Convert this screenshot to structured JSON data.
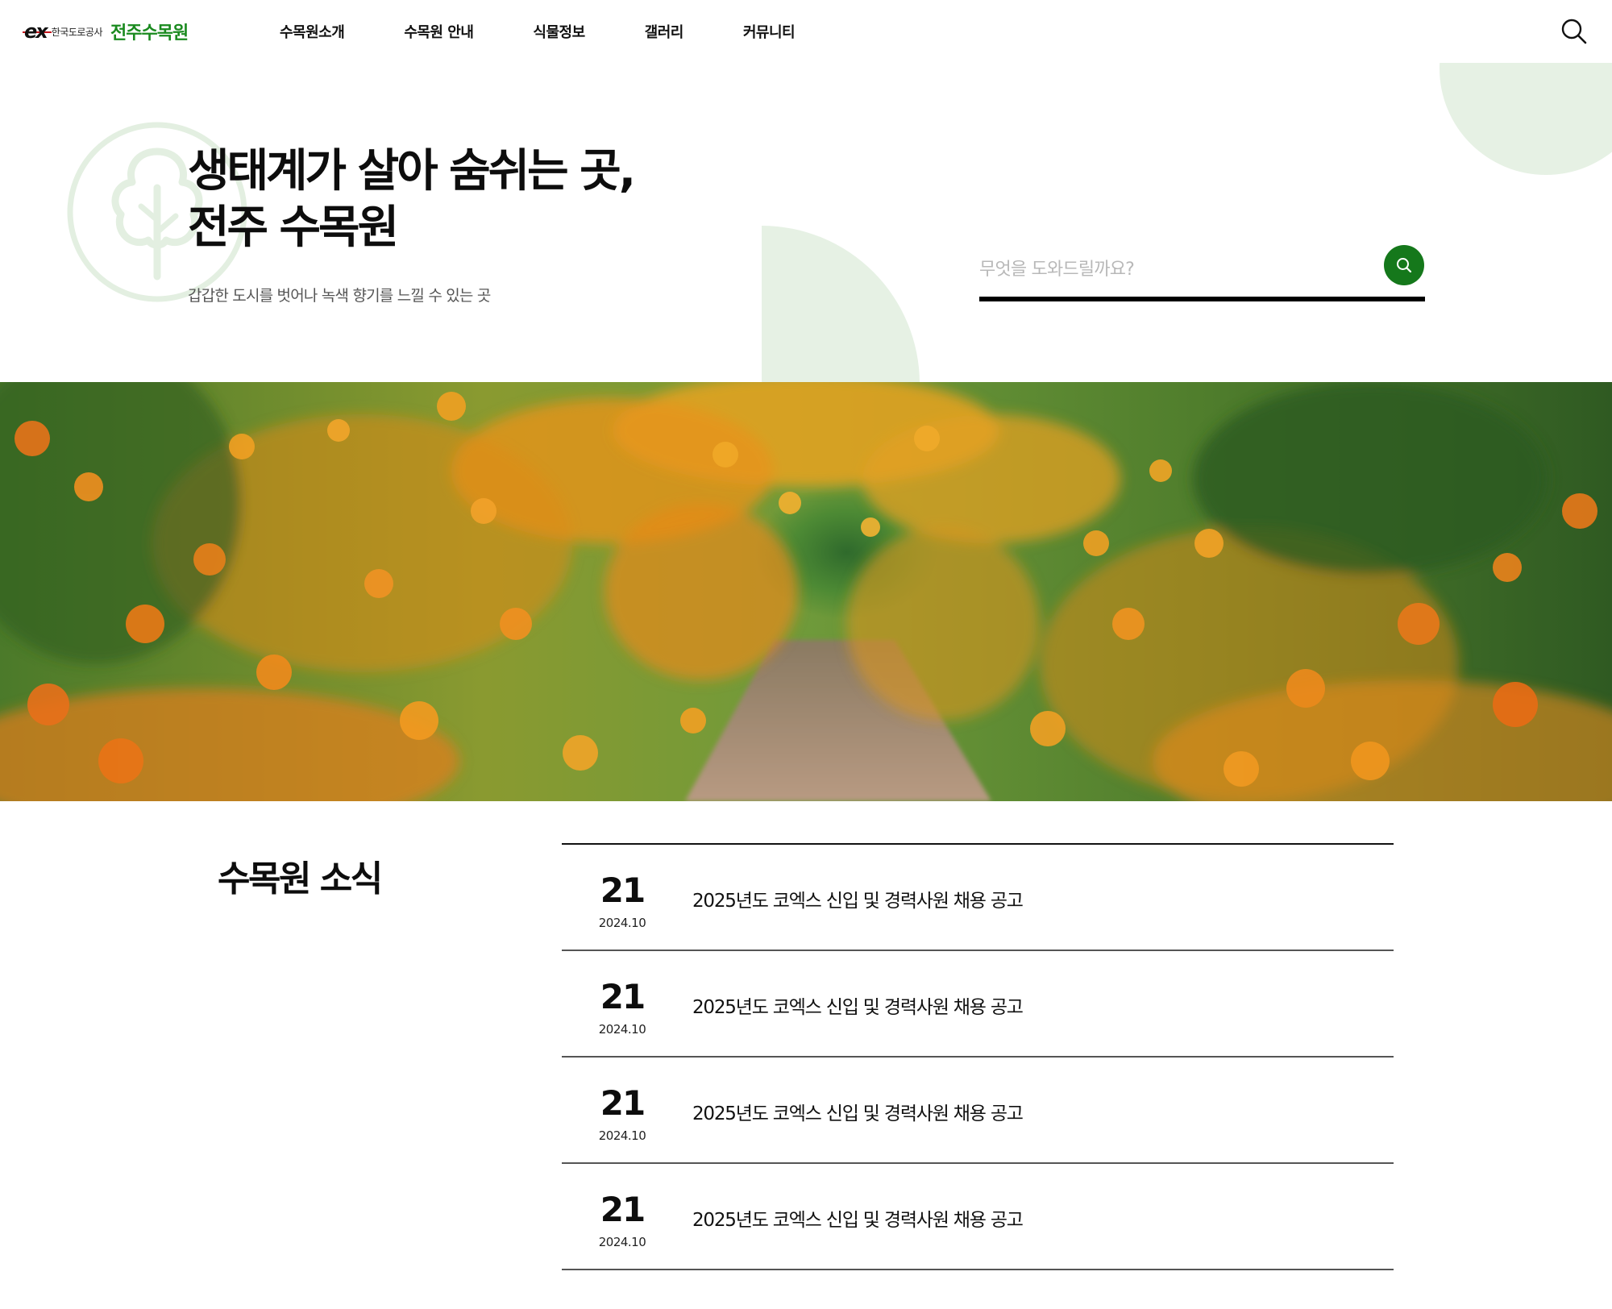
{
  "header": {
    "logo_mark": "ex",
    "org_name": "한국도로공사",
    "site_name": "전주수목원",
    "nav": [
      {
        "label": "수목원소개"
      },
      {
        "label": "수목원 안내"
      },
      {
        "label": "식물정보"
      },
      {
        "label": "갤러리"
      },
      {
        "label": "커뮤니티"
      }
    ],
    "search_icon": "search-icon"
  },
  "hero": {
    "title_line1": "생태계가 살아 숨쉬는 곳,",
    "title_line2": "전주 수목원",
    "subtitle": "갑갑한 도시를 벗어나 녹색 향기를 느낄 수 있는 곳",
    "search_placeholder": "무엇을 도와드릴까요?",
    "search_button_icon": "search-icon"
  },
  "banner": {
    "image": "flower-path-photo"
  },
  "news": {
    "title": "수목원 소식",
    "items": [
      {
        "day": "21",
        "ym": "2024.10",
        "text": "2025년도 코엑스 신입 및 경력사원 채용 공고"
      },
      {
        "day": "21",
        "ym": "2024.10",
        "text": "2025년도 코엑스 신입 및 경력사원 채용 공고"
      },
      {
        "day": "21",
        "ym": "2024.10",
        "text": "2025년도 코엑스 신입 및 경력사원 채용 공고"
      },
      {
        "day": "21",
        "ym": "2024.10",
        "text": "2025년도 코엑스 신입 및 경력사원 채용 공고"
      }
    ]
  },
  "colors": {
    "brand_green": "#1a8a1f",
    "button_green": "#15781b",
    "deco_green": "#e6f1e4",
    "text_dark": "#0d0d0d"
  }
}
